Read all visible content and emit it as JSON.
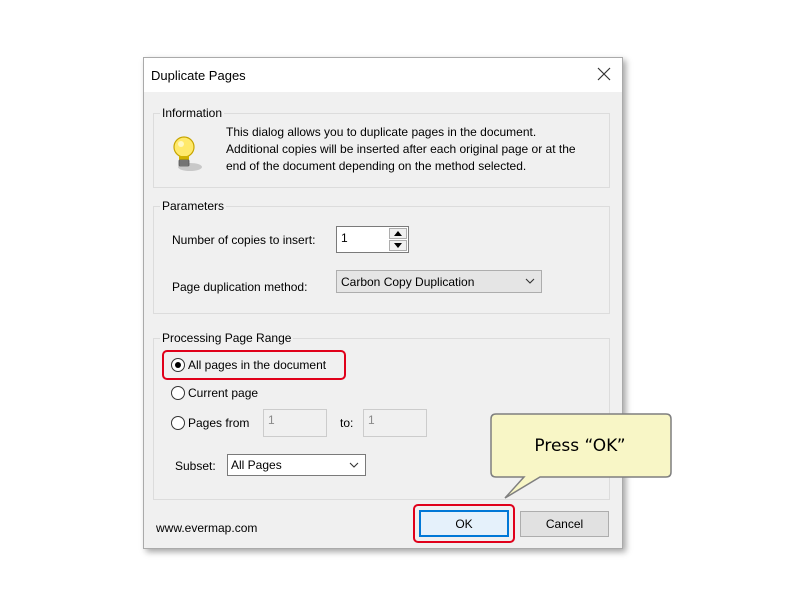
{
  "dialog": {
    "title": "Duplicate Pages",
    "information": {
      "legend": "Information",
      "text_lines": [
        "This dialog allows you to duplicate pages in the document.",
        "Additional copies will be inserted after each original page or at the",
        "end of the document depending on the method selected."
      ],
      "icon": "lightbulb-icon"
    },
    "parameters": {
      "legend": "Parameters",
      "copies_label": "Number of copies to insert:",
      "copies_value": "1",
      "method_label": "Page duplication method:",
      "method_value": "Carbon Copy Duplication"
    },
    "range": {
      "legend": "Processing Page Range",
      "options": [
        "All pages in the document",
        "Current page",
        "Pages from"
      ],
      "selected": "All pages in the document",
      "from_value": "1",
      "to_label": "to:",
      "to_value": "1",
      "subset_label": "Subset:",
      "subset_value": "All Pages"
    },
    "footer": {
      "link": "www.evermap.com",
      "ok_label": "OK",
      "cancel_label": "Cancel"
    }
  },
  "callout": {
    "text": "Press “OK”",
    "fill": "#f8f6c6",
    "stroke": "#7f7f7f"
  },
  "colors": {
    "highlight": "#e0001a",
    "default_button_border": "#0078d7"
  }
}
